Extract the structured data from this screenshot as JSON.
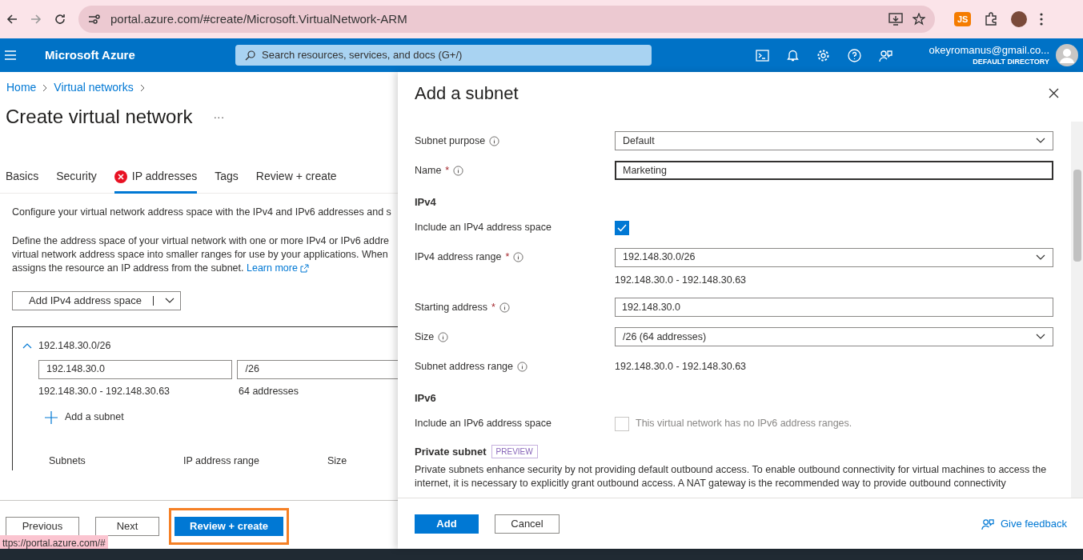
{
  "browser": {
    "url": "portal.azure.com/#create/Microsoft.VirtualNetwork-ARM",
    "extension_badge": "JS"
  },
  "header": {
    "brand": "Microsoft Azure",
    "search_placeholder": "Search resources, services, and docs (G+/)",
    "account": "okeyromanus@gmail.co...",
    "directory": "DEFAULT DIRECTORY"
  },
  "breadcrumb": [
    "Home",
    "Virtual networks"
  ],
  "page_title": "Create virtual network",
  "more": "···",
  "tabs": [
    {
      "label": "Basics",
      "selected": false,
      "error": false
    },
    {
      "label": "Security",
      "selected": false,
      "error": false
    },
    {
      "label": "IP addresses",
      "selected": true,
      "error": true
    },
    {
      "label": "Tags",
      "selected": false,
      "error": false
    },
    {
      "label": "Review + create",
      "selected": false,
      "error": false
    }
  ],
  "intro": "Configure your virtual network address space with the IPv4 and IPv6 addresses and s",
  "description_lines": [
    "Define the address space of your virtual network with one or more IPv4 or IPv6 addre",
    "virtual network address space into smaller ranges for use by your applications. When"
  ],
  "description_last": "assigns the resource an IP address from the subnet.",
  "learn_more": "Learn more",
  "add_space_button": "Add IPv4 address space",
  "address_space": {
    "title": "192.148.30.0/26",
    "expanded": true,
    "address": "192.148.30.0",
    "prefix": "/26",
    "range": "192.148.30.0 - 192.148.30.63",
    "count": "64 addresses",
    "add_subnet": "Add a subnet",
    "columns": [
      "Subnets",
      "IP address range",
      "Size"
    ]
  },
  "footer": {
    "buttons": [
      "Previous",
      "Next"
    ],
    "primary": "Review + create",
    "status_url": "ttps://portal.azure.com/#"
  },
  "panel": {
    "title": "Add a subnet",
    "fields": [
      {
        "kind": "dropdown",
        "label": "Subnet purpose",
        "value": "Default"
      },
      {
        "kind": "input",
        "label": "Name",
        "required_mark": "*",
        "value": "Marketing",
        "focused": true
      },
      {
        "kind": "heading",
        "label": "IPv4"
      },
      {
        "kind": "checkbox",
        "label": "Include an IPv4 address space",
        "checked": true,
        "disabled": false
      },
      {
        "kind": "dropdown",
        "label": "IPv4 address range",
        "required_mark": "*",
        "value": "192.148.30.0/26",
        "hint": "192.148.30.0 - 192.148.30.63"
      },
      {
        "kind": "input",
        "label": "Starting address",
        "required_mark": "*",
        "value": "192.148.30.0",
        "focused": false
      },
      {
        "kind": "dropdown",
        "label": "Size",
        "value": "/26 (64 addresses)"
      },
      {
        "kind": "text",
        "label": "Subnet address range",
        "value": "192.148.30.0 - 192.148.30.63"
      },
      {
        "kind": "heading",
        "label": "IPv6"
      },
      {
        "kind": "checkbox",
        "label": "Include an IPv6 address space",
        "checked": false,
        "disabled": true,
        "note": "This virtual network has no IPv6 address ranges."
      }
    ],
    "private_subnet": {
      "title": "Private subnet",
      "badge": "PREVIEW",
      "text": "Private subnets enhance security by not providing default outbound access. To enable outbound connectivity for virtual machines to access the internet, it is necessary to explicitly grant outbound access. A NAT gateway is the recommended way to provide outbound connectivity"
    },
    "add": "Add",
    "cancel": "Cancel",
    "feedback": "Give feedback"
  }
}
